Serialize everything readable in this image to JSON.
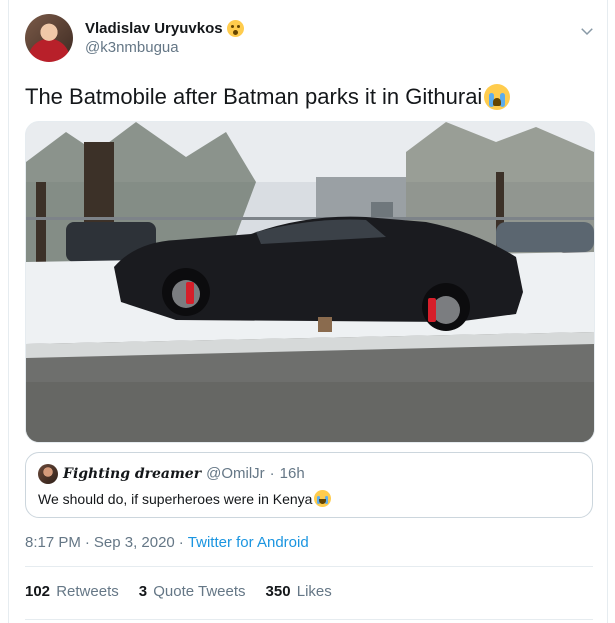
{
  "author": {
    "display_name": "Vladislav Uryuvkos",
    "handle": "@k3nmbugua",
    "name_emoji": "hushed-face-emoji"
  },
  "tweet": {
    "text": "The Batmobile after Batman parks it in Githurai",
    "text_emoji": "crying-face-emoji"
  },
  "quoted": {
    "name": "Fighting dreamer",
    "handle": "@OmilJr",
    "dot": "·",
    "time": "16h",
    "text": "We should do, if superheroes were in Kenya",
    "text_emoji": "laughing-tears-emoji"
  },
  "meta": {
    "time": "8:17 PM",
    "sep1": "·",
    "date": "Sep 3, 2020",
    "sep2": "·",
    "source": "Twitter for Android"
  },
  "stats": {
    "retweets_count": "102",
    "retweets_label": "Retweets",
    "quotes_count": "3",
    "quotes_label": "Quote Tweets",
    "likes_count": "350",
    "likes_label": "Likes"
  },
  "icons": {
    "menu": "chevron-down-icon"
  },
  "colors": {
    "link": "#1b95e0",
    "secondary_text": "#657786",
    "border": "#e6ecf0"
  }
}
